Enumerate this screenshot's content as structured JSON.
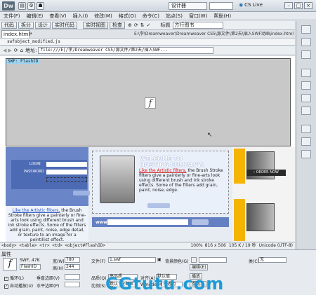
{
  "app": {
    "logo": "Dw",
    "workspace": "设计器",
    "cs_live": "CS Live"
  },
  "window_buttons": [
    "–",
    "□",
    "×"
  ],
  "menu": [
    "文件(F)",
    "编辑(E)",
    "查看(V)",
    "插入(I)",
    "修改(M)",
    "格式(O)",
    "命令(C)",
    "站点(S)",
    "窗口(W)",
    "帮助(H)"
  ],
  "view_buttons": [
    "代码",
    "拆分",
    "设计",
    "实时代码",
    "实时视图",
    "检查"
  ],
  "title_label": "标题",
  "title_value": "方行图书",
  "document": {
    "tab": "index.html*",
    "path": "E:\\李\\Dreamweaver\\Dreamweaver CS5\\源文件\\第2天\\插入SWF动画\\index.html",
    "related_file": "swfobject_modified.js",
    "address_label": "地址:",
    "address": "file:///E|/李/Dreamweaver CS5/源文件/第2天/插入SWF..."
  },
  "flash": {
    "tag": "SWF: FlashID",
    "glyph": "f"
  },
  "webpage": {
    "login_label": "LOGIN",
    "password_label": "PASSWORD",
    "promo_link": "Like the Artistic filters,",
    "promo_text": " the Brush Stroke filters give a painterly or fine-arts look using different brush and ink stroke effects. Some of the filters add grain, paint, noise, edge detail, or texture to an image for a pointillist effect.",
    "hosting_title_1": "WELCOME TO",
    "hosting_title_2": "HOSTING COMPANY!",
    "hosting_link": "Like the Artistic filters,",
    "hosting_text": " the Brush Stroke filters give a painterly or fine-arts look using different brush and ink stroke effects. Some of the filters add grain, paint, noise, edge.",
    "more_label": "MORE",
    "www_label": "www",
    "order_label": "› ORDER NOW"
  },
  "status": {
    "tags": "<body> <table> <tr> <td> <object#FlashID>",
    "zoom": "100%",
    "size": "816 x 506",
    "filesize": "105 K / 19 秒",
    "encoding": "Unicode (UTF-8)"
  },
  "properties": {
    "panel_title": "属性",
    "type": "SWF, 47K",
    "id": "FlashID",
    "width_label": "宽(W)",
    "width": "780",
    "height_label": "高(H)",
    "height": "244",
    "file_label": "文件(F)",
    "file": "1.swf",
    "bg_label": "背景颜色(G)",
    "class_label": "类(C)",
    "class_value": "无",
    "edit_label": "编辑(E)",
    "loop_label": "循环(L)",
    "autoplay_label": "自动播放(U)",
    "vspace_label": "垂直边距(V)",
    "hspace_label": "水平边距(P)",
    "quality_label": "品质(Q)",
    "quality": "高品质",
    "scale_label": "比例(S)",
    "scale": "默认 (全部显示)",
    "align_label": "对齐(A)",
    "align": "默认值",
    "wmode_label": "Wmode(M)",
    "wmode": "不透明",
    "play_label": "播放",
    "params_label": "参数..."
  },
  "watermark": "CGtutu.com"
}
